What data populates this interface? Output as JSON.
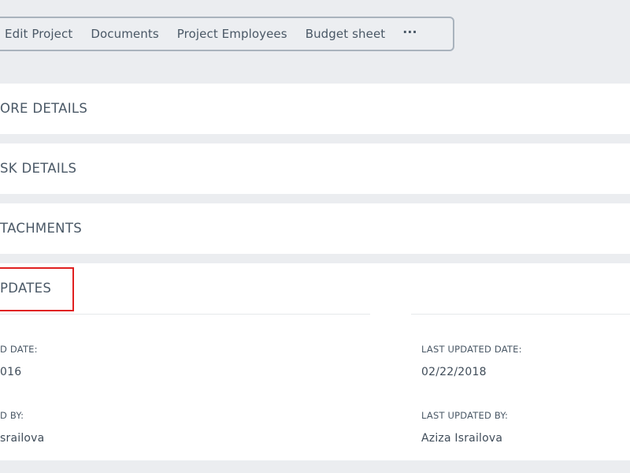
{
  "toolbar": {
    "items": [
      {
        "label": "Edit Project"
      },
      {
        "label": "Documents"
      },
      {
        "label": "Project Employees"
      },
      {
        "label": "Budget sheet"
      }
    ],
    "more_label": "···"
  },
  "sections": {
    "more_details": {
      "title": "ORE DETAILS"
    },
    "task_details": {
      "title": "SK DETAILS"
    },
    "attachments": {
      "title": "TACHMENTS"
    },
    "updates": {
      "title": "PDATES",
      "created_date_label": "D DATE:",
      "created_date_value": "016",
      "created_by_label": "D BY:",
      "created_by_value": "srailova",
      "last_updated_date_label": "LAST UPDATED DATE:",
      "last_updated_date_value": "02/22/2018",
      "last_updated_by_label": "LAST UPDATED BY:",
      "last_updated_by_value": "Aziza Israilova"
    }
  },
  "colors": {
    "background": "#ebedf0",
    "panel": "#ffffff",
    "text": "#4a5866",
    "highlight_border": "#e02020",
    "toolbar_border": "#a9b3bd"
  }
}
